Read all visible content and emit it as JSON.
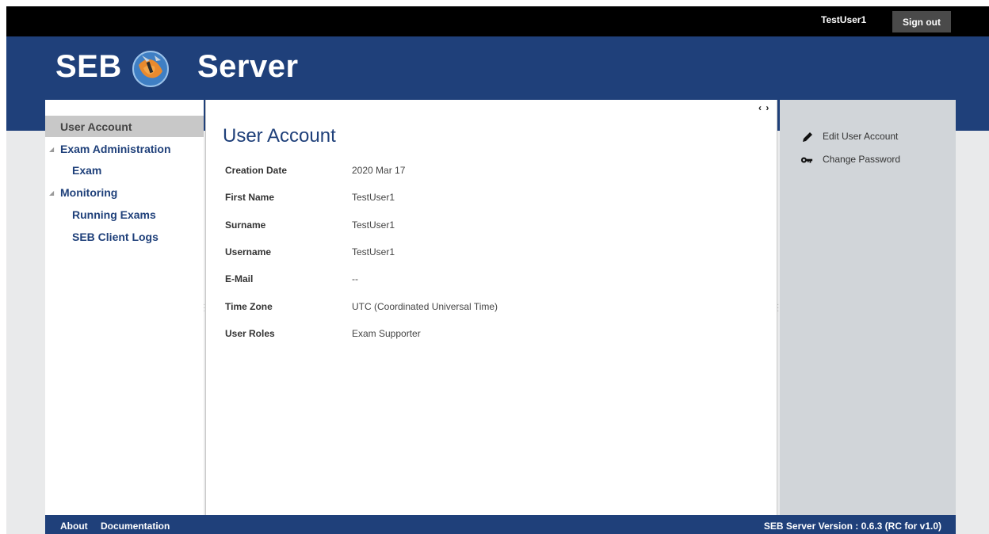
{
  "topbar": {
    "username": "TestUser1",
    "sign_out": "Sign out"
  },
  "header": {
    "logo_left": "SEB",
    "logo_right": "Server",
    "emblem_icon": "seb-globe-emblem-icon"
  },
  "sidebar": {
    "items": [
      {
        "label": "User Account"
      },
      {
        "label": "Exam Administration"
      },
      {
        "label": "Exam"
      },
      {
        "label": "Monitoring"
      },
      {
        "label": "Running Exams"
      },
      {
        "label": "SEB Client Logs"
      }
    ]
  },
  "main": {
    "title": "User Account",
    "fields": [
      {
        "label": "Creation Date",
        "value": "2020 Mar 17"
      },
      {
        "label": "First Name",
        "value": "TestUser1"
      },
      {
        "label": "Surname",
        "value": "TestUser1"
      },
      {
        "label": "Username",
        "value": "TestUser1"
      },
      {
        "label": "E-Mail",
        "value": "--"
      },
      {
        "label": "Time Zone",
        "value": "UTC (Coordinated Universal Time)"
      },
      {
        "label": "User Roles",
        "value": "Exam Supporter"
      }
    ]
  },
  "actions": {
    "items": [
      {
        "label": "Edit User Account",
        "icon": "pencil-icon"
      },
      {
        "label": "Change Password",
        "icon": "key-icon"
      }
    ]
  },
  "footer": {
    "about": "About",
    "documentation": "Documentation",
    "version": "SEB Server Version : 0.6.3 (RC for v1.0)"
  },
  "colors": {
    "brand_blue": "#1f407a",
    "topbar": "#000000",
    "actions_panel": "#d1d5d9",
    "active_nav": "#c8c8c8"
  }
}
